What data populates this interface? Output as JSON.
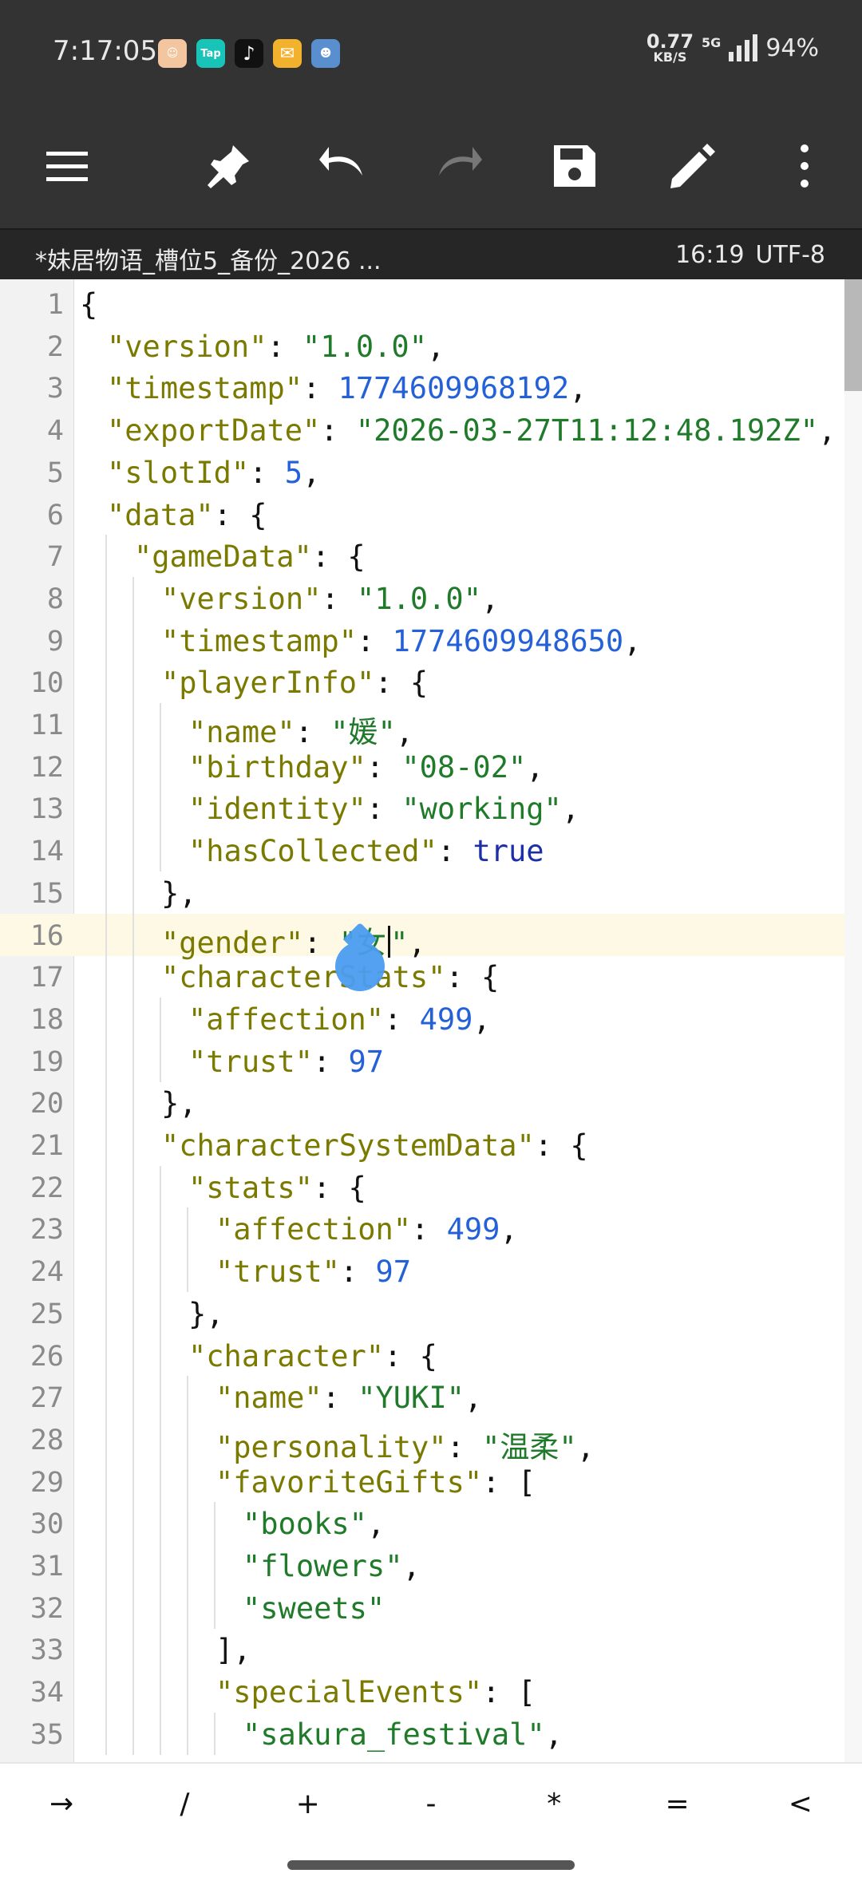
{
  "status_bar": {
    "time": "7:17:05",
    "notification_icons": [
      "app-icon-1",
      "taptap-icon",
      "tiktok-icon",
      "mail-icon",
      "app-icon-5"
    ],
    "taptap_label": "Tap",
    "net_speed": "0.77",
    "net_speed_unit": "KB/S",
    "network": "5G",
    "battery": "94%"
  },
  "toolbar": {
    "buttons": [
      "menu-icon",
      "pin-icon",
      "undo-icon",
      "redo-icon",
      "save-icon",
      "edit-icon",
      "more-icon"
    ],
    "redo_enabled": false
  },
  "tab": {
    "filename": "*妹居物语_槽位5_备份_2026 ...",
    "cursor": "16:19",
    "encoding": "UTF-8"
  },
  "editor": {
    "active_line": 16,
    "lines": [
      {
        "n": "1",
        "indent": 0,
        "code": [
          [
            "p",
            "{"
          ]
        ]
      },
      {
        "n": "2",
        "indent": 1,
        "code": [
          [
            "k",
            "\"version\""
          ],
          [
            "p",
            ": "
          ],
          [
            "s",
            "\"1.0.0\""
          ],
          [
            "p",
            ","
          ]
        ]
      },
      {
        "n": "3",
        "indent": 1,
        "code": [
          [
            "k",
            "\"timestamp\""
          ],
          [
            "p",
            ": "
          ],
          [
            "n",
            "1774609968192"
          ],
          [
            "p",
            ","
          ]
        ]
      },
      {
        "n": "4",
        "indent": 1,
        "code": [
          [
            "k",
            "\"exportDate\""
          ],
          [
            "p",
            ": "
          ],
          [
            "s",
            "\"2026-03-27T11:12:48.192Z\""
          ],
          [
            "p",
            ","
          ]
        ]
      },
      {
        "n": "5",
        "indent": 1,
        "code": [
          [
            "k",
            "\"slotId\""
          ],
          [
            "p",
            ": "
          ],
          [
            "n",
            "5"
          ],
          [
            "p",
            ","
          ]
        ]
      },
      {
        "n": "6",
        "indent": 1,
        "code": [
          [
            "k",
            "\"data\""
          ],
          [
            "p",
            ": {"
          ]
        ]
      },
      {
        "n": "7",
        "indent": 2,
        "code": [
          [
            "k",
            "\"gameData\""
          ],
          [
            "p",
            ": {"
          ]
        ]
      },
      {
        "n": "8",
        "indent": 3,
        "code": [
          [
            "k",
            "\"version\""
          ],
          [
            "p",
            ": "
          ],
          [
            "s",
            "\"1.0.0\""
          ],
          [
            "p",
            ","
          ]
        ]
      },
      {
        "n": "9",
        "indent": 3,
        "code": [
          [
            "k",
            "\"timestamp\""
          ],
          [
            "p",
            ": "
          ],
          [
            "n",
            "1774609948650"
          ],
          [
            "p",
            ","
          ]
        ]
      },
      {
        "n": "10",
        "indent": 3,
        "code": [
          [
            "k",
            "\"playerInfo\""
          ],
          [
            "p",
            ": {"
          ]
        ]
      },
      {
        "n": "11",
        "indent": 4,
        "code": [
          [
            "k",
            "\"name\""
          ],
          [
            "p",
            ": "
          ],
          [
            "s",
            "\"媛\""
          ],
          [
            "p",
            ","
          ]
        ]
      },
      {
        "n": "12",
        "indent": 4,
        "code": [
          [
            "k",
            "\"birthday\""
          ],
          [
            "p",
            ": "
          ],
          [
            "s",
            "\"08-02\""
          ],
          [
            "p",
            ","
          ]
        ]
      },
      {
        "n": "13",
        "indent": 4,
        "code": [
          [
            "k",
            "\"identity\""
          ],
          [
            "p",
            ": "
          ],
          [
            "s",
            "\"working\""
          ],
          [
            "p",
            ","
          ]
        ]
      },
      {
        "n": "14",
        "indent": 4,
        "code": [
          [
            "k",
            "\"hasCollected\""
          ],
          [
            "p",
            ": "
          ],
          [
            "b",
            "true"
          ]
        ]
      },
      {
        "n": "15",
        "indent": 3,
        "code": [
          [
            "p",
            "},"
          ]
        ]
      },
      {
        "n": "16",
        "indent": 3,
        "code": [
          [
            "k",
            "\"gender\""
          ],
          [
            "p",
            ": "
          ],
          [
            "s",
            "\"女"
          ],
          [
            "caret",
            ""
          ],
          [
            "s",
            "\""
          ],
          [
            "p",
            ","
          ]
        ]
      },
      {
        "n": "17",
        "indent": 3,
        "code": [
          [
            "k",
            "\"characterStats\""
          ],
          [
            "p",
            ": {"
          ]
        ]
      },
      {
        "n": "18",
        "indent": 4,
        "code": [
          [
            "k",
            "\"affection\""
          ],
          [
            "p",
            ": "
          ],
          [
            "n",
            "499"
          ],
          [
            "p",
            ","
          ]
        ]
      },
      {
        "n": "19",
        "indent": 4,
        "code": [
          [
            "k",
            "\"trust\""
          ],
          [
            "p",
            ": "
          ],
          [
            "n",
            "97"
          ]
        ]
      },
      {
        "n": "20",
        "indent": 3,
        "code": [
          [
            "p",
            "},"
          ]
        ]
      },
      {
        "n": "21",
        "indent": 3,
        "code": [
          [
            "k",
            "\"characterSystemData\""
          ],
          [
            "p",
            ": {"
          ]
        ]
      },
      {
        "n": "22",
        "indent": 4,
        "code": [
          [
            "k",
            "\"stats\""
          ],
          [
            "p",
            ": {"
          ]
        ]
      },
      {
        "n": "23",
        "indent": 5,
        "code": [
          [
            "k",
            "\"affection\""
          ],
          [
            "p",
            ": "
          ],
          [
            "n",
            "499"
          ],
          [
            "p",
            ","
          ]
        ]
      },
      {
        "n": "24",
        "indent": 5,
        "code": [
          [
            "k",
            "\"trust\""
          ],
          [
            "p",
            ": "
          ],
          [
            "n",
            "97"
          ]
        ]
      },
      {
        "n": "25",
        "indent": 4,
        "code": [
          [
            "p",
            "},"
          ]
        ]
      },
      {
        "n": "26",
        "indent": 4,
        "code": [
          [
            "k",
            "\"character\""
          ],
          [
            "p",
            ": {"
          ]
        ]
      },
      {
        "n": "27",
        "indent": 5,
        "code": [
          [
            "k",
            "\"name\""
          ],
          [
            "p",
            ": "
          ],
          [
            "s",
            "\"YUKI\""
          ],
          [
            "p",
            ","
          ]
        ]
      },
      {
        "n": "28",
        "indent": 5,
        "code": [
          [
            "k",
            "\"personality\""
          ],
          [
            "p",
            ": "
          ],
          [
            "s",
            "\"温柔\""
          ],
          [
            "p",
            ","
          ]
        ]
      },
      {
        "n": "29",
        "indent": 5,
        "code": [
          [
            "k",
            "\"favoriteGifts\""
          ],
          [
            "p",
            ": ["
          ]
        ]
      },
      {
        "n": "30",
        "indent": 6,
        "code": [
          [
            "s",
            "\"books\""
          ],
          [
            "p",
            ","
          ]
        ]
      },
      {
        "n": "31",
        "indent": 6,
        "code": [
          [
            "s",
            "\"flowers\""
          ],
          [
            "p",
            ","
          ]
        ]
      },
      {
        "n": "32",
        "indent": 6,
        "code": [
          [
            "s",
            "\"sweets\""
          ]
        ]
      },
      {
        "n": "33",
        "indent": 5,
        "code": [
          [
            "p",
            "],"
          ]
        ]
      },
      {
        "n": "34",
        "indent": 5,
        "code": [
          [
            "k",
            "\"specialEvents\""
          ],
          [
            "p",
            ": ["
          ]
        ]
      },
      {
        "n": "35",
        "indent": 6,
        "code": [
          [
            "s",
            "\"sakura_festival\""
          ],
          [
            "p",
            ","
          ]
        ]
      }
    ]
  },
  "symbols": [
    "→",
    "/",
    "+",
    "-",
    "*",
    "=",
    "<"
  ],
  "colors": {
    "bar_bg": "#333333",
    "key": "#7a7a00",
    "string": "#1f7a2a",
    "number": "#2460d8",
    "boolean": "#1c2fa8",
    "active_line": "#fdf9e4",
    "selection_handle": "#4a9df0"
  }
}
